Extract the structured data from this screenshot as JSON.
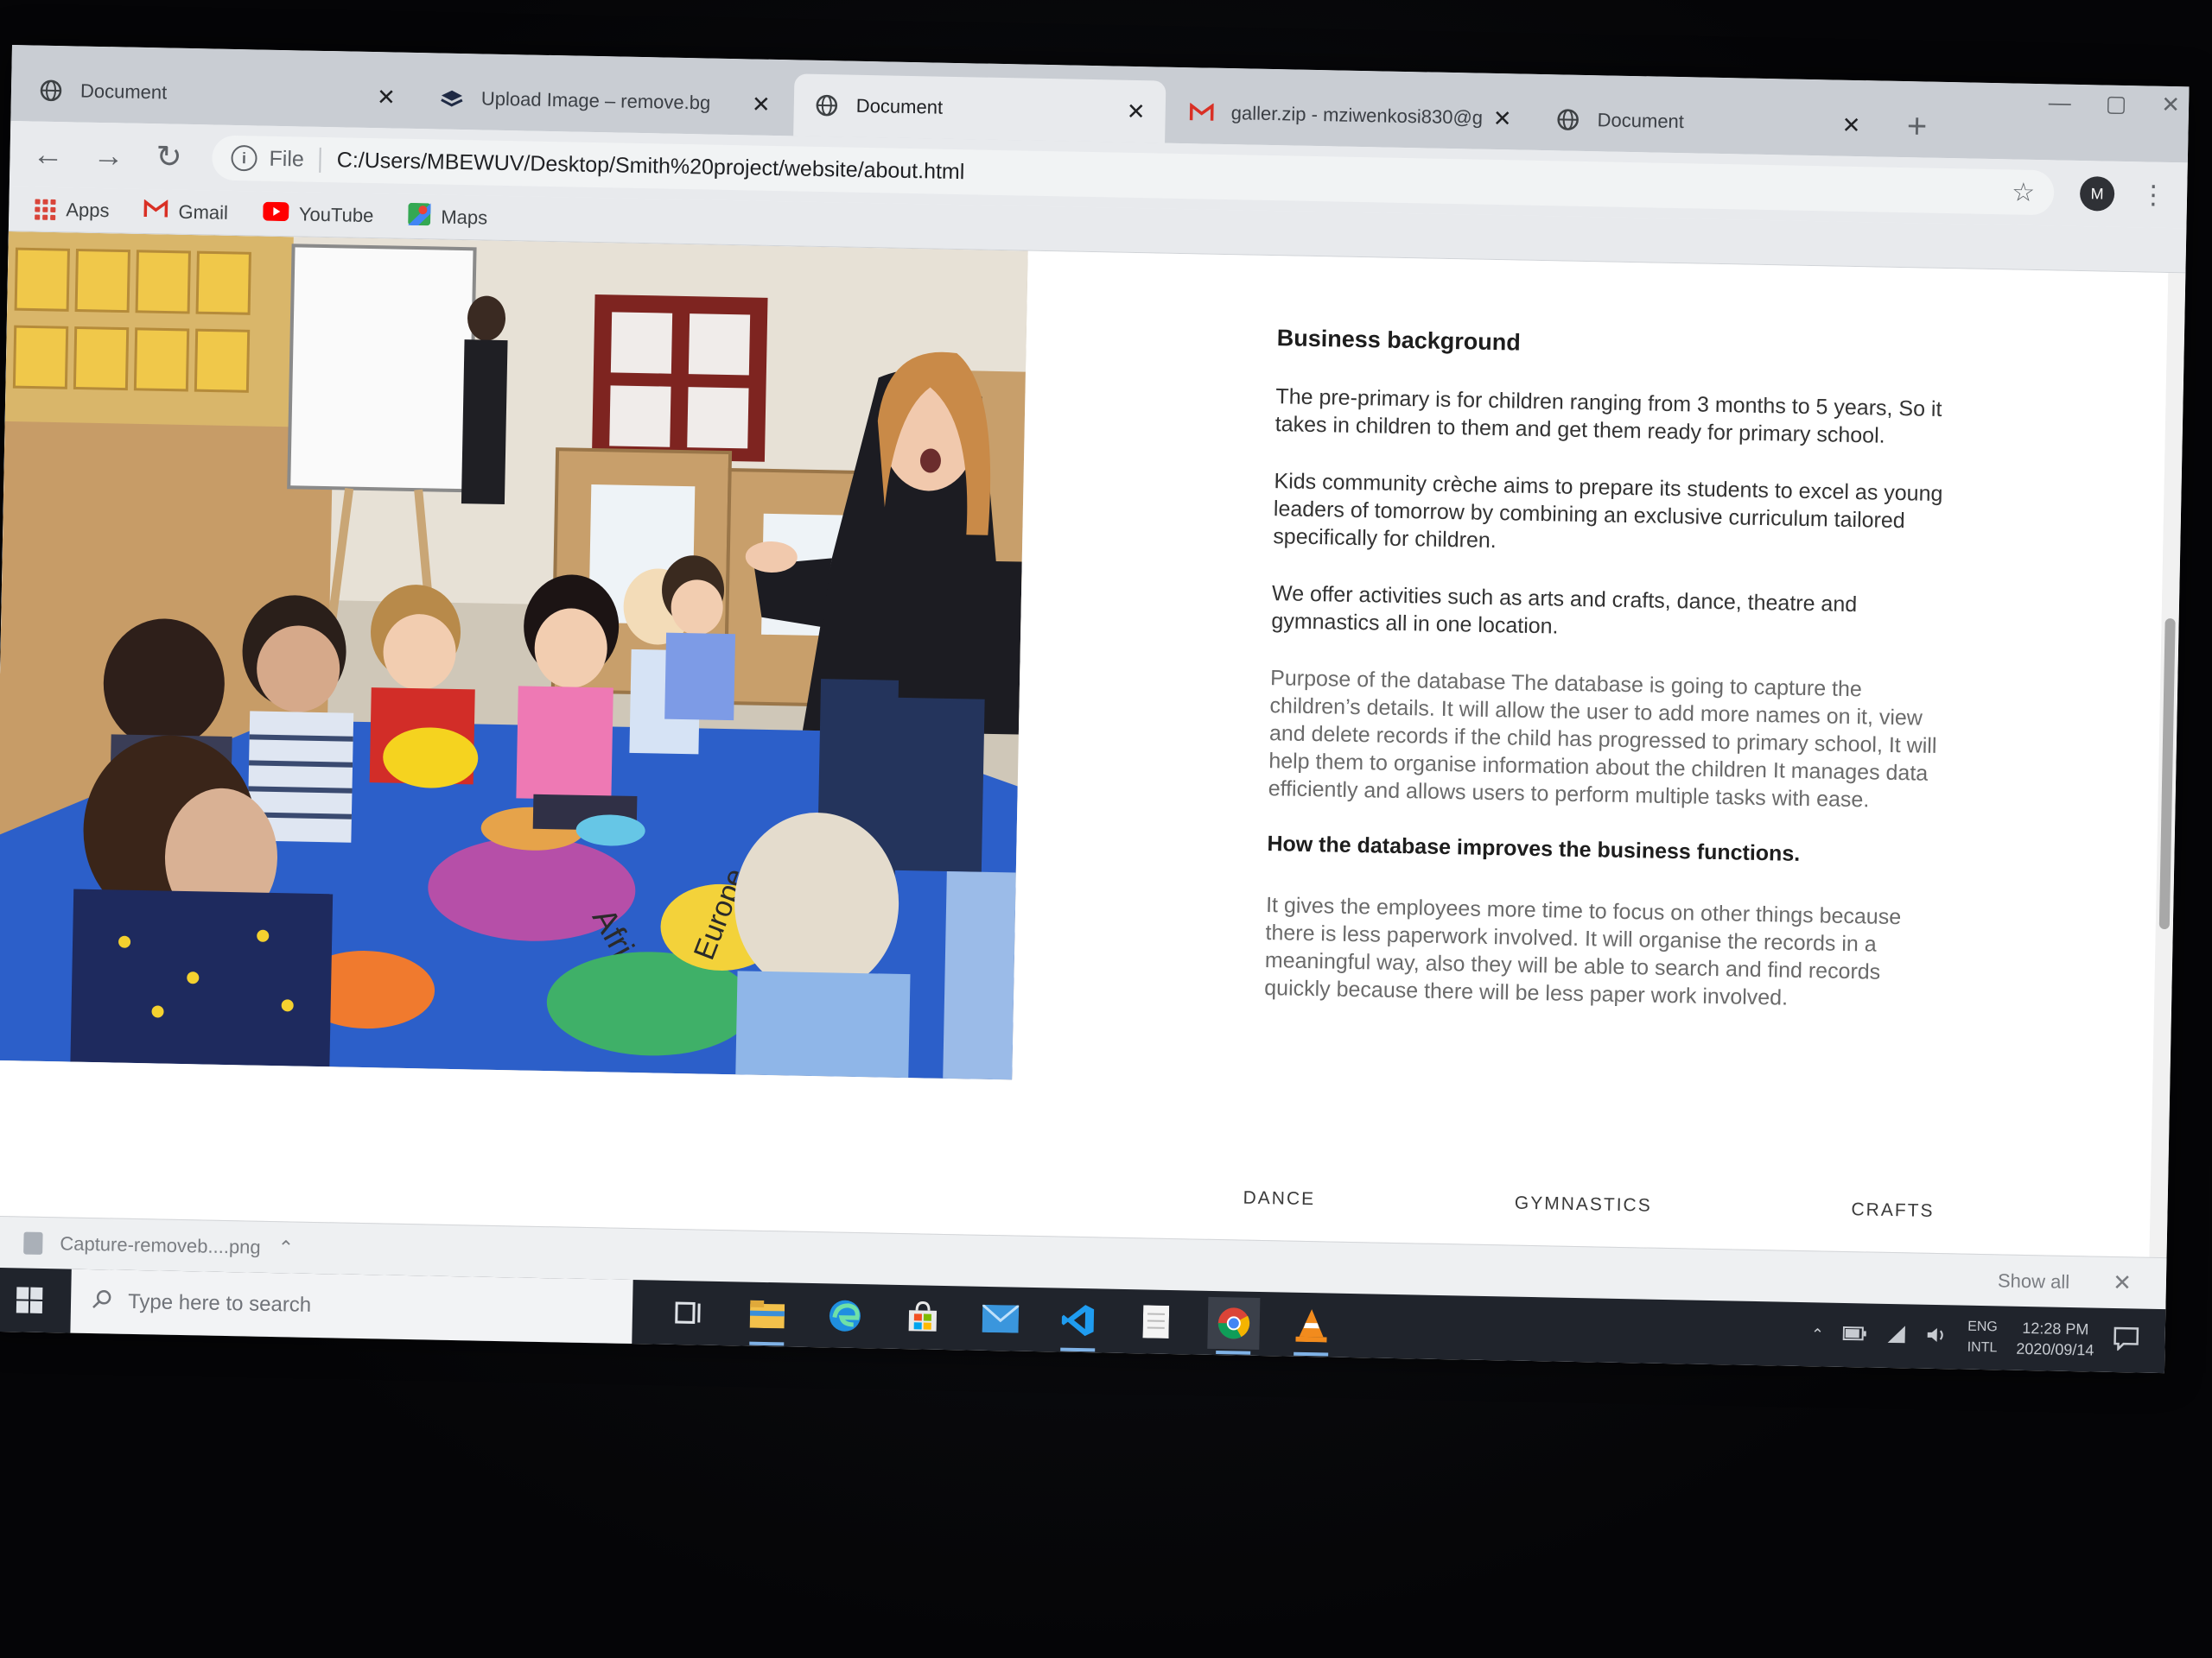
{
  "browser": {
    "tabs": [
      {
        "title": "Document",
        "active": false
      },
      {
        "title": "Upload Image – remove.bg",
        "active": false
      },
      {
        "title": "Document",
        "active": true
      },
      {
        "title": "galler.zip - mziwenkosi830@g",
        "active": false
      },
      {
        "title": "Document",
        "active": false
      }
    ],
    "new_tab": "+",
    "omnibox": {
      "scheme_label": "File",
      "url": "C:/Users/MBEWUV/Desktop/Smith%20project/website/about.html"
    },
    "profile_initial": "M",
    "bookmarks": [
      {
        "label": "Apps",
        "icon": "apps-grid-icon"
      },
      {
        "label": "Gmail",
        "icon": "gmail-icon"
      },
      {
        "label": "YouTube",
        "icon": "youtube-icon"
      },
      {
        "label": "Maps",
        "icon": "maps-icon"
      }
    ]
  },
  "page": {
    "heading": "Business background",
    "paragraphs": [
      "The pre-primary is for children ranging from 3 months to 5 years, So it takes in children to them and get them ready for primary school.",
      "Kids community crèche aims to prepare its students to excel as young leaders of tomorrow by combining an exclusive curriculum tailored specifically for children.",
      "We offer activities such as arts and crafts, dance, theatre and gymnastics all in one location.",
      "Purpose of the database The database is going to capture the children’s details. It will allow the user to add more names on it, view and delete records if the child has progressed to primary school, It will help them to organise information about the children It manages data efficiently and allows users to perform multiple tasks with ease."
    ],
    "subheading": "How the database improves the business functions.",
    "improvements": "It gives the employees more time to focus on other things because there is less paperwork involved. It will organise the records in a meaningful way, also they will be able to search and find records quickly because there will be less paper work involved.",
    "activities": [
      "DANCE",
      "GYMNASTICS",
      "CRAFTS"
    ],
    "photo_map_labels": [
      "Africa",
      "Europe"
    ]
  },
  "downloads": {
    "file": "Capture-removeb....png",
    "show_all": "Show all"
  },
  "taskbar": {
    "search_placeholder": "Type here to search",
    "lang_top": "ENG",
    "lang_bottom": "INTL",
    "time": "12:28 PM",
    "date": "2020/09/14"
  },
  "colors": {
    "tab_strip": "#c9cdd3",
    "toolbar": "#e8eaed",
    "taskbar": "#20242c",
    "gmail_red": "#d93025",
    "youtube_red": "#ff0000"
  }
}
